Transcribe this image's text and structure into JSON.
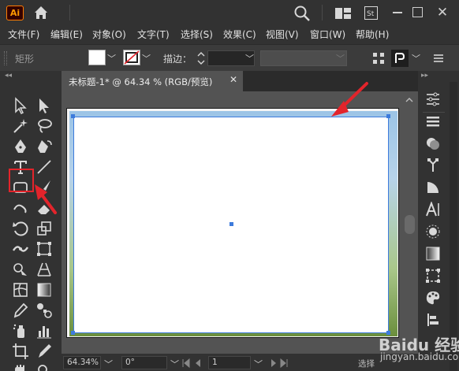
{
  "titlebar": {
    "logo_text": "Ai",
    "icons": [
      "home-icon",
      "search-icon",
      "workspace-layout-icon",
      "adobe-stock-icon",
      "minimize-icon",
      "maximize-icon",
      "close-icon"
    ],
    "close_glyph": "✕"
  },
  "menu": {
    "items": [
      {
        "label": "文件(F)"
      },
      {
        "label": "编辑(E)"
      },
      {
        "label": "对象(O)"
      },
      {
        "label": "文字(T)"
      },
      {
        "label": "选择(S)"
      },
      {
        "label": "效果(C)"
      },
      {
        "label": "视图(V)"
      },
      {
        "label": "窗口(W)"
      },
      {
        "label": "帮助(H)"
      }
    ]
  },
  "controlbar": {
    "selection_label": "矩形",
    "stroke_label": "描边：",
    "stroke_value": "",
    "fill_color": "#ffffff",
    "stroke_color": "none",
    "chevron": "﹀"
  },
  "collapse": {
    "left": "◂◂",
    "right": "▸▸"
  },
  "document": {
    "tab_title": "未标题-1* @ 64.34 % (RGB/预览)",
    "tab_close": "✕"
  },
  "statusbar": {
    "zoom": "64.34%",
    "rotation": "0°",
    "artboard_number": "1",
    "status_text": "选择"
  },
  "tools": [
    "selection-tool-icon",
    "direct-selection-tool-icon",
    "magic-wand-tool-icon",
    "lasso-tool-icon",
    "pen-tool-icon",
    "curvature-tool-icon",
    "type-tool-icon",
    "line-segment-tool-icon",
    "rounded-rectangle-tool-icon",
    "paintbrush-tool-icon",
    "shaper-tool-icon",
    "eraser-tool-icon",
    "rotate-tool-icon",
    "scale-tool-icon",
    "width-tool-icon",
    "free-transform-tool-icon",
    "shape-builder-tool-icon",
    "perspective-grid-tool-icon",
    "mesh-tool-icon",
    "gradient-tool-icon",
    "eyedropper-tool-icon",
    "blend-tool-icon",
    "symbol-sprayer-tool-icon",
    "column-graph-tool-icon",
    "artboard-tool-icon",
    "slice-tool-icon",
    "hand-tool-icon",
    "zoom-tool-icon"
  ],
  "right_panel": [
    "properties-icon",
    "layers-icon",
    "appearance-icon",
    "libraries-icon",
    "transparency-icon",
    "character-icon",
    "sun-icon",
    "gradient-panel-icon",
    "align-icon",
    "color-icon",
    "stroke-align-icon"
  ],
  "colors": {
    "accent_selection": "#3d7bdc",
    "annotation_red": "#e3242b",
    "ui_dark": "#323232",
    "canvas_grey": "#535353"
  },
  "watermark": {
    "brand": "Baidu 经验",
    "sub": "jingyan.baidu.com"
  }
}
